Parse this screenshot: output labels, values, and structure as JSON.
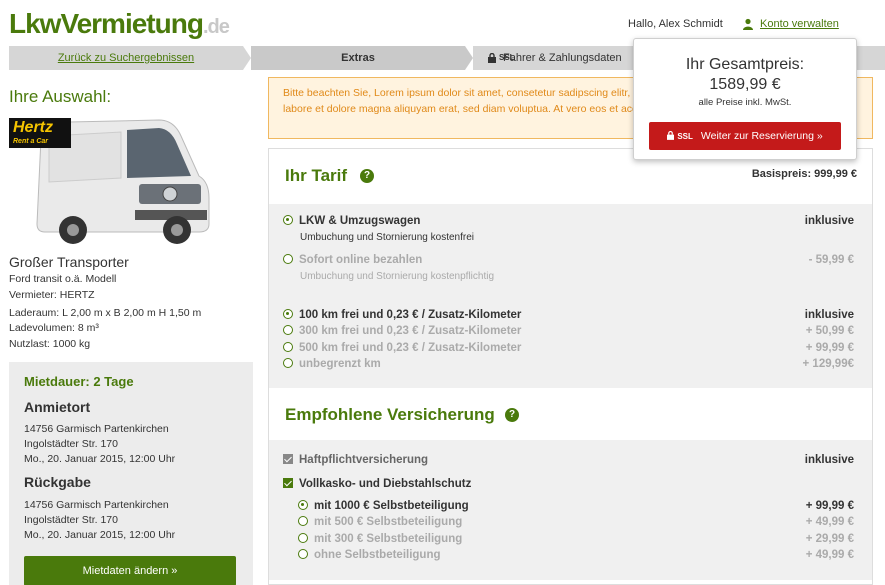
{
  "header": {
    "logo_main": "LkwVermietung",
    "logo_suffix": ".de",
    "greeting": "Hallo, Alex Schmidt",
    "account_link": "Konto verwalten"
  },
  "steps": {
    "back": "Zurück zu Suchergebnissen",
    "current": "Extras",
    "ssl_badge": "SSL",
    "next": "Fahrer & Zahlungsdaten"
  },
  "sidebar": {
    "heading": "Ihre Auswahl:",
    "brand_logo": "Hertz",
    "brand_tagline": "Rent a Car",
    "vehicle_name": "Großer Transporter",
    "vehicle_lines": [
      "Ford transit o.ä. Modell",
      "Vermieter: HERTZ",
      "Laderaum: L 2,00 m x B 2,00 m H 1,50 m",
      "Ladevolumen: 8 m³",
      "Nutzlast: 1000 kg"
    ],
    "rental": {
      "duration": "Mietdauer: 2 Tage",
      "pickup_title": "Anmietort",
      "pickup_lines": [
        "14756 Garmisch Partenkirchen",
        "Ingolstädter Str. 170",
        "Mo., 20. Januar 2015, 12:00 Uhr"
      ],
      "return_title": "Rückgabe",
      "return_lines": [
        "14756 Garmisch Partenkirchen",
        "Ingolstädter Str. 170",
        "Mo., 20. Januar 2015, 12:00 Uhr"
      ],
      "change_button": "Mietdaten ändern »"
    }
  },
  "notice": "Bitte beachten Sie, Lorem ipsum dolor sit amet, consetetur sadipscing elitr, sed diam nonumy eirmod tempor invidunt ut labore et dolore magna aliquyam erat, sed diam voluptua. At vero eos et accusam et justo duo dolores et ea rebum.",
  "price_popup": {
    "title": "Ihr Gesamtpreis:",
    "price": "1589,99 €",
    "note": "alle Preise inkl. MwSt.",
    "ssl_badge": "SSL",
    "button": "Weiter zur Reservierung »"
  },
  "tarif": {
    "title": "Ihr Tarif",
    "basis": "Basispreis: 999,99 €",
    "options": [
      {
        "label": "LKW & Umzugswagen",
        "sub": "Umbuchung und Stornierung kostenfrei",
        "price": "inklusive",
        "selected": true
      },
      {
        "label": "Sofort online bezahlen",
        "sub": "Umbuchung und Stornierung kostenpflichtig",
        "price": "- 59,99 €",
        "selected": false
      }
    ],
    "km_options": [
      {
        "label": "100 km frei und 0,23 € / Zusatz-Kilometer",
        "price": "inklusive",
        "selected": true
      },
      {
        "label": "300 km frei und 0,23 € / Zusatz-Kilometer",
        "price": "+ 50,99 €",
        "selected": false
      },
      {
        "label": "500 km frei und 0,23 € / Zusatz-Kilometer",
        "price": "+ 99,99 €",
        "selected": false
      },
      {
        "label": "unbegrenzt km",
        "price": "+ 129,99€",
        "selected": false
      }
    ]
  },
  "insurance": {
    "title": "Empfohlene Versicherung",
    "haftpflicht": {
      "label": "Haftpflichtversicherung",
      "price": "inklusive"
    },
    "vollkasko": {
      "label": "Vollkasko- und Diebstahlschutz"
    },
    "deductibles": [
      {
        "label": "mit 1000 € Selbstbeteiligung",
        "price": "+ 99,99 €",
        "selected": true
      },
      {
        "label": "mit 500 € Selbstbeteiligung",
        "price": "+ 49,99 €",
        "selected": false
      },
      {
        "label": "mit 300 € Selbstbeteiligung",
        "price": "+ 29,99 €",
        "selected": false
      },
      {
        "label": "ohne Selbstbeteiligung",
        "price": "+ 49,99 €",
        "selected": false
      }
    ]
  },
  "colors": {
    "brand_green": "#4a7a0c",
    "cta_red": "#c41a1a",
    "notice_orange": "#e08a1a"
  }
}
